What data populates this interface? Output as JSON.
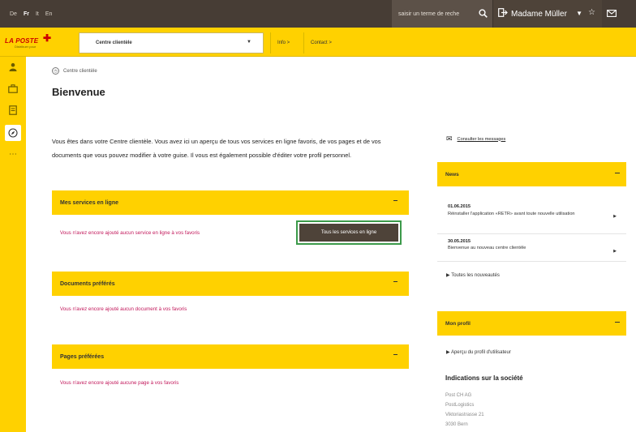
{
  "topbar": {
    "languages": [
      {
        "label": "De",
        "active": false
      },
      {
        "label": "Fr",
        "active": true
      },
      {
        "label": "It",
        "active": false
      },
      {
        "label": "En",
        "active": false
      }
    ],
    "search_placeholder": "saisir un terme de reche",
    "user_name": "Madame Müller",
    "icons": [
      "search-icon",
      "login-icon",
      "chevron-down-icon",
      "star-icon",
      "mail-icon"
    ]
  },
  "navbar": {
    "logo_text": "LA POSTE",
    "logo_tagline": "Distribuer pour",
    "select_value": "Centre clientèle",
    "links": [
      "Info >",
      "Contact >"
    ]
  },
  "rail": {
    "items": [
      "user-icon",
      "briefcase-icon",
      "receipt-icon",
      "compass-icon",
      "more-icon"
    ]
  },
  "main": {
    "breadcrumb": "Centre clientèle",
    "title": "Bienvenue",
    "intro": "Vous êtes dans votre Centre clientèle. Vous avez ici un aperçu de tous vos services en ligne favoris, de vos pages et de vos documents que vous pouvez modifier à votre guise. Il vous est également possible d'éditer votre profil personnel.",
    "sections": [
      {
        "title": "Mes services en ligne",
        "empty": "Vous n'avez encore ajouté aucun service en ligne à vos favoris",
        "button": "Tous les services en ligne"
      },
      {
        "title": "Documents préférés",
        "empty": "Vous n'avez encore ajouté aucun document à vos favoris"
      },
      {
        "title": "Pages préférées",
        "empty": "Vous n'avez encore ajouté aucune page à vos favoris"
      }
    ]
  },
  "right": {
    "messages_link": "Consulter les messages",
    "news_title": "News",
    "news": [
      {
        "date": "01.06.2015",
        "text": "Réinstaller l'application «RETR» avant toute nouvelle utilisation"
      },
      {
        "date": "30.05.2015",
        "text": "Bienvenue au nouveau centre clientèle"
      }
    ],
    "all_news": "Toutes les nouveautés",
    "profile_title": "Mon profil",
    "profile_link": "Aperçu du profil d'utilisateur",
    "company_title": "Indications sur la société",
    "company_lines": [
      "Post CH AG",
      "PostLogistics",
      "Viktoriastrasse 21",
      "3030 Bern"
    ]
  }
}
